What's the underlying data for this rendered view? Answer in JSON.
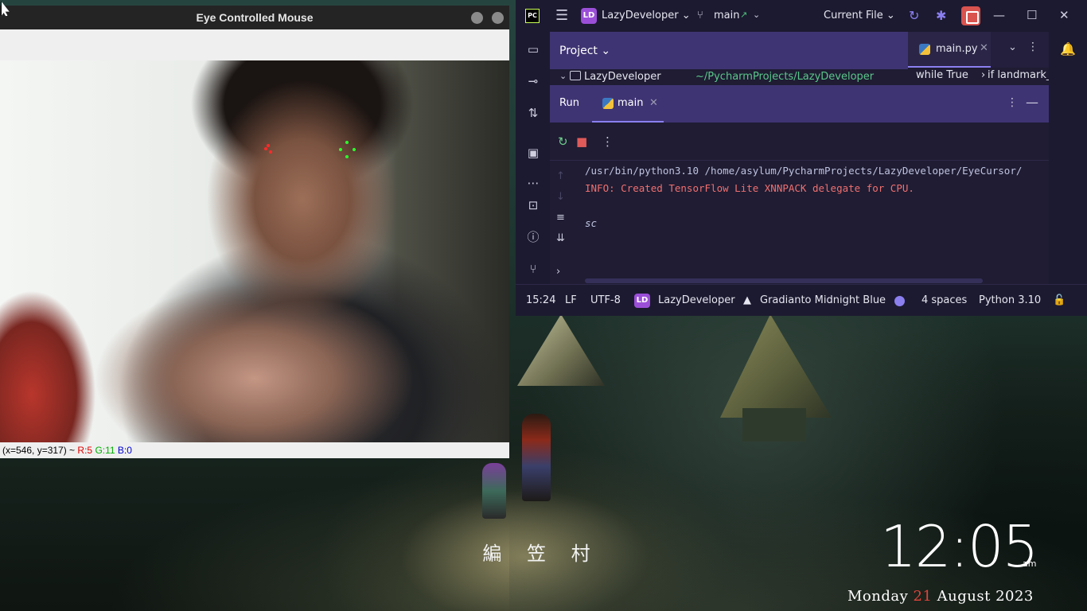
{
  "camera_window": {
    "title": "Eye Controlled Mouse",
    "status": {
      "coords": "(x=546, y=317) ~",
      "r": "R:5",
      "g": "G:11",
      "b": "B:0"
    }
  },
  "ide": {
    "logo": "PC",
    "project_badge": "LD",
    "project_name": "LazyDeveloper",
    "branch": "main",
    "run_config": "Current File",
    "project_panel_label": "Project",
    "tree": {
      "root_name": "LazyDeveloper",
      "root_path": "~/PycharmProjects/LazyDeveloper"
    },
    "editor_tab": "main.py",
    "breadcrumbs": [
      "while True",
      "if landmark_p"
    ],
    "run_panel": {
      "label": "Run",
      "tab": "main"
    },
    "console": {
      "cmd": "/usr/bin/python3.10 /home/asylum/PycharmProjects/LazyDeveloper/EyeCursor/",
      "info": "INFO: Created TensorFlow Lite XNNPACK delegate for CPU.",
      "input": "sc"
    },
    "status_bar": {
      "position": "15:24",
      "line_sep": "LF",
      "encoding": "UTF-8",
      "project_badge": "LD",
      "project": "LazyDeveloper",
      "theme": "Gradianto Midnight Blue",
      "indent": "4 spaces",
      "interpreter": "Python 3.10"
    },
    "colors": {
      "accent": "#8b7ff0",
      "header_bg": "#3f3473",
      "bg": "#1f1c33",
      "error_text": "#f07070",
      "path_green": "#5ac78a"
    }
  },
  "desktop": {
    "wallpaper_caption": "編 笠 村",
    "clock": {
      "time": "12:05",
      "ampm": "am",
      "weekday": "Monday",
      "day": "21",
      "month_year": "August 2023"
    }
  }
}
